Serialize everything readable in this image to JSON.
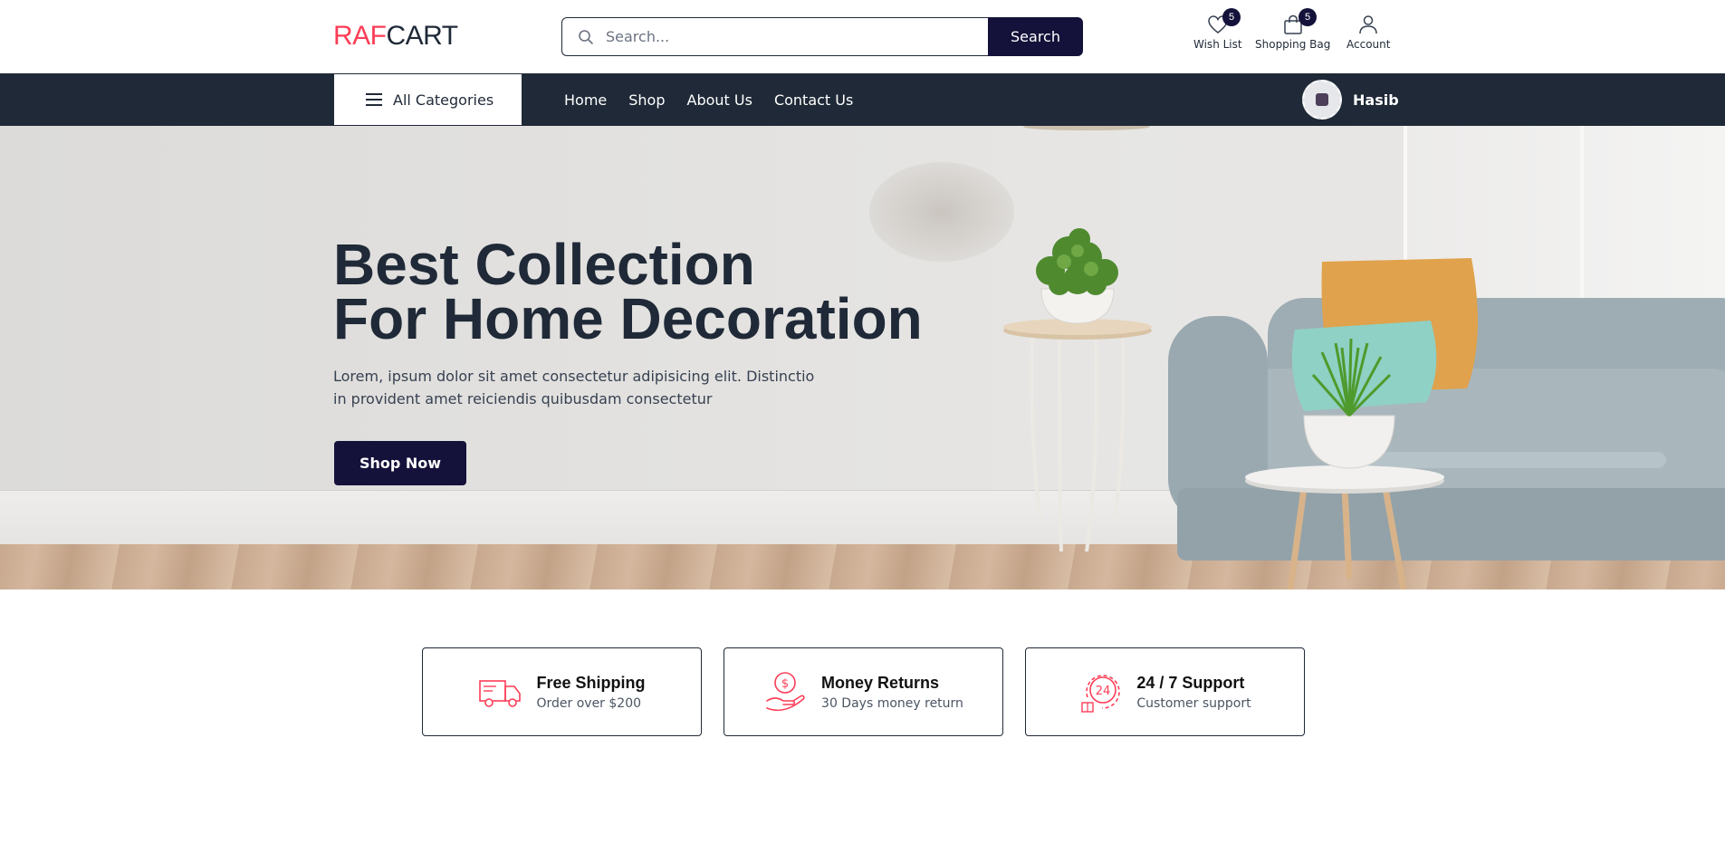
{
  "brand": {
    "logo_part1": "RAF",
    "logo_part2": "CART",
    "accent": "#fd3d57",
    "primary": "#14123a",
    "dark": "#1f2937"
  },
  "header": {
    "search": {
      "placeholder": "Search...",
      "button_label": "Search"
    },
    "wishlist": {
      "label": "Wish List",
      "count": "5",
      "icon": "heart-icon"
    },
    "bag": {
      "label": "Shopping Bag",
      "count": "5",
      "icon": "bag-icon"
    },
    "account": {
      "label": "Account",
      "icon": "user-icon"
    }
  },
  "nav": {
    "all_categories": "All Categories",
    "links": [
      "Home",
      "Shop",
      "About Us",
      "Contact Us"
    ],
    "user_name": "Hasib"
  },
  "hero": {
    "title_line1": "Best Collection",
    "title_line2": "For Home Decoration",
    "text_line1": "Lorem, ipsum dolor sit amet consectetur adipisicing elit. Distinctio",
    "text_line2": "in provident amet reiciendis quibusdam consectetur",
    "button_label": "Shop Now"
  },
  "features": [
    {
      "title": "Free Shipping",
      "subtitle": "Order over $200",
      "icon": "truck-icon"
    },
    {
      "title": "Money Returns",
      "subtitle": "30 Days money return",
      "icon": "money-hand-icon"
    },
    {
      "title": "24 / 7 Support",
      "subtitle": "Customer support",
      "icon": "support-24-icon"
    }
  ]
}
